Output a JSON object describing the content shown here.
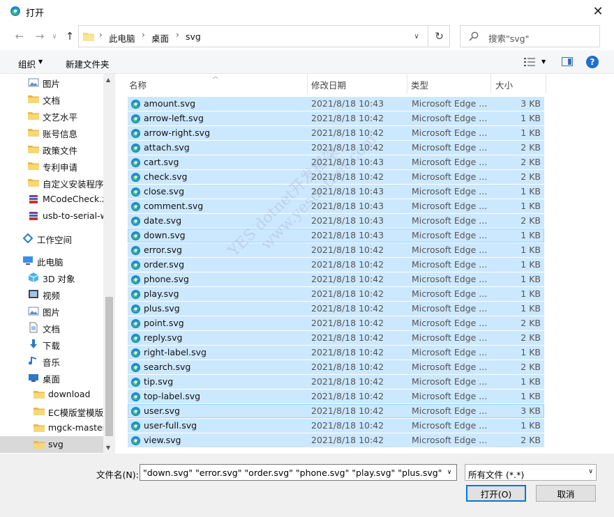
{
  "window": {
    "title": "打开",
    "close_glyph": "✕"
  },
  "nav": {
    "back_glyph": "←",
    "forward_glyph": "→",
    "history_glyph": "∨",
    "up_glyph": "↑",
    "breadcrumbs": [
      "此电脑",
      "桌面",
      "svg"
    ],
    "crumb_separator": "›",
    "refresh_glyph": "↻",
    "search_placeholder": "搜索\"svg\""
  },
  "toolbar": {
    "organize_label": "组织",
    "new_folder_label": "新建文件夹",
    "help_glyph": "?",
    "caret_glyph": "▼"
  },
  "sidebar": {
    "items": [
      {
        "label": "图片",
        "icon": "pictures-icon",
        "indent": "quick"
      },
      {
        "label": "文档",
        "icon": "folder-icon",
        "indent": "quick"
      },
      {
        "label": "文艺水平",
        "icon": "folder-icon",
        "indent": "quick"
      },
      {
        "label": "账号信息",
        "icon": "folder-icon",
        "indent": "quick"
      },
      {
        "label": "政策文件",
        "icon": "folder-icon",
        "indent": "quick"
      },
      {
        "label": "专利申请",
        "icon": "folder-icon",
        "indent": "quick"
      },
      {
        "label": "自定义安装程序",
        "icon": "folder-icon",
        "indent": "quick"
      },
      {
        "label": "MCodeCheck.z",
        "icon": "archive-icon",
        "indent": "quick"
      },
      {
        "label": "usb-to-serial-w",
        "icon": "archive-icon",
        "indent": "quick"
      },
      {
        "label": "",
        "icon": "",
        "indent": "gap"
      },
      {
        "label": "工作空间",
        "icon": "workspace-icon",
        "indent": "root"
      },
      {
        "label": "",
        "icon": "",
        "indent": "gap"
      },
      {
        "label": "此电脑",
        "icon": "computer-icon",
        "indent": "root"
      },
      {
        "label": "3D 对象",
        "icon": "3d-objects-icon",
        "indent": "quick"
      },
      {
        "label": "视频",
        "icon": "video-icon",
        "indent": "quick"
      },
      {
        "label": "图片",
        "icon": "pictures-icon",
        "indent": "quick"
      },
      {
        "label": "文档",
        "icon": "documents-icon",
        "indent": "quick"
      },
      {
        "label": "下载",
        "icon": "download-icon",
        "indent": "quick"
      },
      {
        "label": "音乐",
        "icon": "music-icon",
        "indent": "quick"
      },
      {
        "label": "桌面",
        "icon": "desktop-icon",
        "indent": "quick"
      },
      {
        "label": "download",
        "icon": "folder-icon",
        "indent": "sub"
      },
      {
        "label": "EC模版堂模版",
        "icon": "folder-icon",
        "indent": "sub"
      },
      {
        "label": "mgck-master",
        "icon": "folder-icon",
        "indent": "sub"
      },
      {
        "label": "svg",
        "icon": "folder-icon",
        "indent": "sub",
        "selected": true
      }
    ]
  },
  "columns": {
    "name": "名称",
    "date": "修改日期",
    "type": "类型",
    "size": "大小"
  },
  "files": [
    {
      "name": "amount.svg",
      "date": "2021/8/18 10:43",
      "type": "Microsoft Edge ...",
      "size": "3 KB"
    },
    {
      "name": "arrow-left.svg",
      "date": "2021/8/18 10:42",
      "type": "Microsoft Edge ...",
      "size": "1 KB"
    },
    {
      "name": "arrow-right.svg",
      "date": "2021/8/18 10:42",
      "type": "Microsoft Edge ...",
      "size": "1 KB"
    },
    {
      "name": "attach.svg",
      "date": "2021/8/18 10:42",
      "type": "Microsoft Edge ...",
      "size": "2 KB"
    },
    {
      "name": "cart.svg",
      "date": "2021/8/18 10:43",
      "type": "Microsoft Edge ...",
      "size": "2 KB"
    },
    {
      "name": "check.svg",
      "date": "2021/8/18 10:42",
      "type": "Microsoft Edge ...",
      "size": "2 KB"
    },
    {
      "name": "close.svg",
      "date": "2021/8/18 10:43",
      "type": "Microsoft Edge ...",
      "size": "1 KB"
    },
    {
      "name": "comment.svg",
      "date": "2021/8/18 10:43",
      "type": "Microsoft Edge ...",
      "size": "1 KB"
    },
    {
      "name": "date.svg",
      "date": "2021/8/18 10:43",
      "type": "Microsoft Edge ...",
      "size": "2 KB"
    },
    {
      "name": "down.svg",
      "date": "2021/8/18 10:43",
      "type": "Microsoft Edge ...",
      "size": "1 KB",
      "focus": true
    },
    {
      "name": "error.svg",
      "date": "2021/8/18 10:42",
      "type": "Microsoft Edge ...",
      "size": "1 KB"
    },
    {
      "name": "order.svg",
      "date": "2021/8/18 10:42",
      "type": "Microsoft Edge ...",
      "size": "1 KB"
    },
    {
      "name": "phone.svg",
      "date": "2021/8/18 10:42",
      "type": "Microsoft Edge ...",
      "size": "1 KB"
    },
    {
      "name": "play.svg",
      "date": "2021/8/18 10:42",
      "type": "Microsoft Edge ...",
      "size": "1 KB"
    },
    {
      "name": "plus.svg",
      "date": "2021/8/18 10:42",
      "type": "Microsoft Edge ...",
      "size": "1 KB"
    },
    {
      "name": "point.svg",
      "date": "2021/8/18 10:42",
      "type": "Microsoft Edge ...",
      "size": "2 KB"
    },
    {
      "name": "reply.svg",
      "date": "2021/8/18 10:42",
      "type": "Microsoft Edge ...",
      "size": "2 KB"
    },
    {
      "name": "right-label.svg",
      "date": "2021/8/18 10:42",
      "type": "Microsoft Edge ...",
      "size": "1 KB"
    },
    {
      "name": "search.svg",
      "date": "2021/8/18 10:42",
      "type": "Microsoft Edge ...",
      "size": "2 KB"
    },
    {
      "name": "tip.svg",
      "date": "2021/8/18 10:42",
      "type": "Microsoft Edge ...",
      "size": "1 KB"
    },
    {
      "name": "top-label.svg",
      "date": "2021/8/18 10:42",
      "type": "Microsoft Edge ...",
      "size": "1 KB"
    },
    {
      "name": "user.svg",
      "date": "2021/8/18 10:42",
      "type": "Microsoft Edge ...",
      "size": "3 KB",
      "focus": true
    },
    {
      "name": "user-full.svg",
      "date": "2021/8/18 10:42",
      "type": "Microsoft Edge ...",
      "size": "1 KB"
    },
    {
      "name": "view.svg",
      "date": "2021/8/18 10:42",
      "type": "Microsoft Edge ...",
      "size": "2 KB"
    }
  ],
  "watermark": {
    "line1": "YES dotnet开发框架",
    "line2": "www.yesdotnet.com"
  },
  "footer": {
    "filename_label": "文件名(N):",
    "filename_value": "\"down.svg\" \"error.svg\" \"order.svg\" \"phone.svg\" \"play.svg\" \"plus.svg\" \"poir",
    "filetype_value": "所有文件 (*.*)",
    "open_label": "打开(O)",
    "cancel_label": "取消",
    "drop_glyph": "∨"
  },
  "colors": {
    "selection": "#cce8ff",
    "accent": "#0078d7",
    "folder": "#f8d775"
  }
}
